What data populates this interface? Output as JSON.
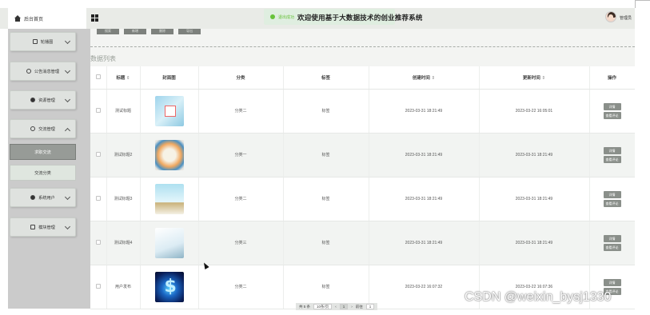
{
  "header": {
    "home_label": "后台首页",
    "toast": "退出成功",
    "app_title": "欢迎使用基于大数据技术的创业推荐系统",
    "user_name": "管理员"
  },
  "sidebar": {
    "items": [
      {
        "label": "轮播图",
        "icon": "image-icon"
      },
      {
        "label": "公告消息管理",
        "icon": "info-icon"
      },
      {
        "label": "资源管理",
        "icon": "pin-icon"
      },
      {
        "label": "交流管理",
        "icon": "chat-icon",
        "open": true
      },
      {
        "label": "系统用户",
        "icon": "user-icon"
      },
      {
        "label": "模块管理",
        "icon": "grid-icon"
      }
    ],
    "sub_items": [
      {
        "label": "求职交流",
        "active": true
      },
      {
        "label": "交流分类",
        "active": false
      }
    ]
  },
  "toolbar": {
    "buttons": [
      "搜索",
      "新增",
      "删除",
      "导出"
    ]
  },
  "section_title": "数据列表",
  "table": {
    "columns": [
      "标题",
      "封面图",
      "分类",
      "标签",
      "创建时间",
      "更新时间",
      "操作"
    ],
    "sort_mark": "⇕",
    "rows": [
      {
        "title": "测试标题",
        "category": "分类二",
        "tag": "标签",
        "created": "2023-03-31 18:21:49",
        "updated": "2023-03-22 16:05:01",
        "cover": "cover-1"
      },
      {
        "title": "测试标题2",
        "category": "分类一",
        "tag": "标签",
        "created": "2023-03-31 18:21:49",
        "updated": "2023-03-31 18:21:49",
        "cover": "cover-2"
      },
      {
        "title": "测试标题3",
        "category": "分类二",
        "tag": "标签",
        "created": "2023-03-31 18:21:49",
        "updated": "2023-03-31 18:21:49",
        "cover": "cover-3"
      },
      {
        "title": "测试标题4",
        "category": "分类三",
        "tag": "标签",
        "created": "2023-03-31 18:21:49",
        "updated": "2023-03-31 18:21:49",
        "cover": "cover-4"
      },
      {
        "title": "用户发布",
        "category": "分类二",
        "tag": "标签",
        "created": "2023-03-22 16:07:32",
        "updated": "2023-03-22 16:07:36",
        "cover": "cover-5"
      }
    ],
    "actions": [
      "详情",
      "查看评论"
    ]
  },
  "pager": {
    "total": "共 5 条",
    "page_size": "10条/页",
    "current": "1",
    "goto_label": "前往",
    "goto_value": "1"
  },
  "watermark": "CSDN @weixin_bysj1330",
  "colors": {
    "accent": "#8a8f8a",
    "toast_green": "#67c23a"
  }
}
